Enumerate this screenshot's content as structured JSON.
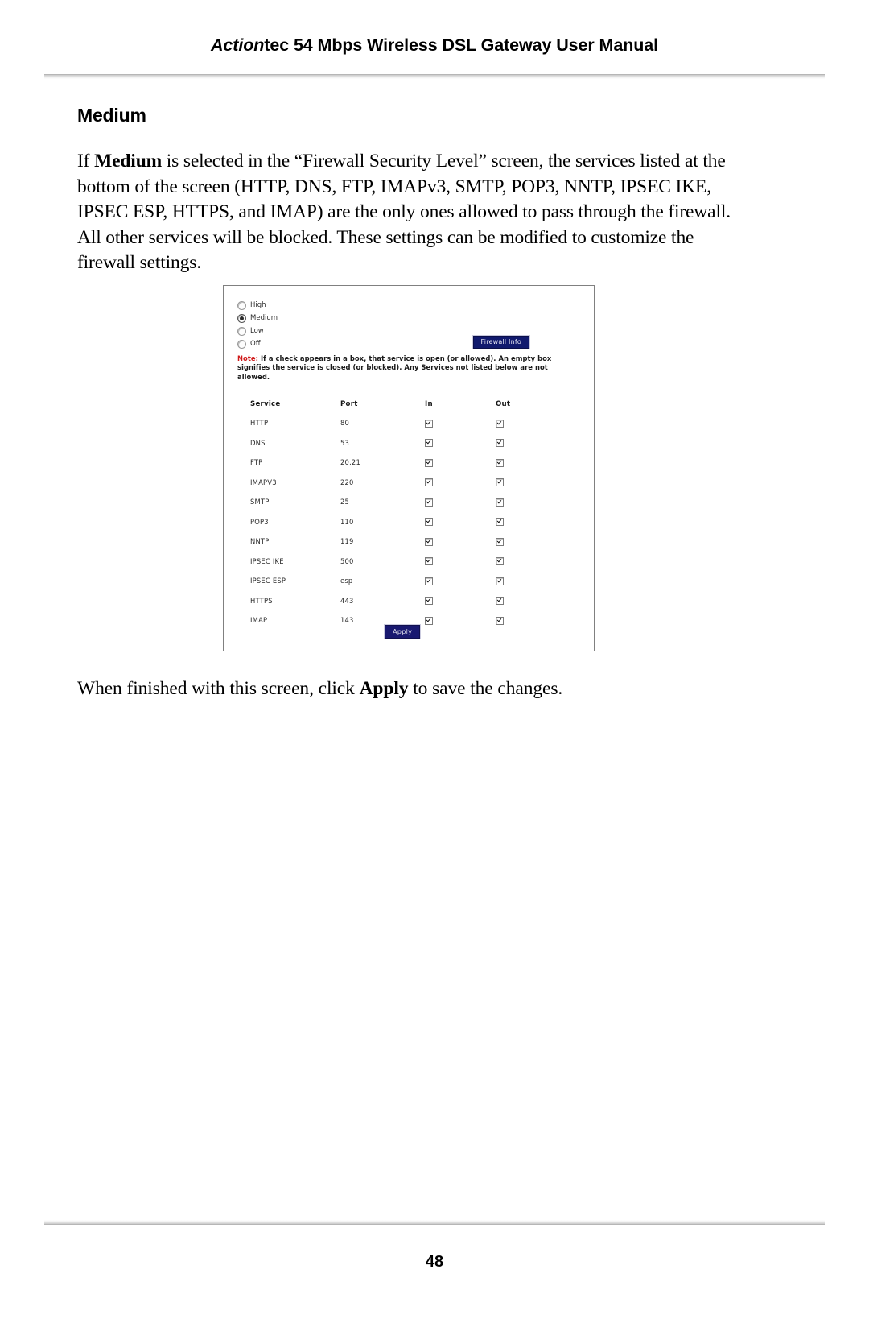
{
  "header": {
    "title_brand": "Action",
    "title_rest": "tec 54 Mbps Wireless DSL Gateway User Manual"
  },
  "section": {
    "heading": "Medium",
    "paragraph_lead": "If ",
    "paragraph_bold": "Medium",
    "paragraph_body": " is selected in the “Firewall Security Level” screen, the services listed at the bottom of the screen (HTTP, DNS, FTP, IMAPv3, SMTP, POP3, NNTP, IPSEC IKE, IPSEC ESP, HTTPS, and IMAP) are the only ones allowed to pass through the firewall. All other services will be blocked. These settings can be modified to customize the firewall settings."
  },
  "screenshot": {
    "security_levels": [
      {
        "label": "High",
        "selected": false
      },
      {
        "label": "Medium",
        "selected": true
      },
      {
        "label": "Low",
        "selected": false
      },
      {
        "label": "Off",
        "selected": false
      }
    ],
    "firewall_info_button": "Firewall Info",
    "note_label": "Note:",
    "note_text": " If a check appears in a box, that service is open (or allowed). An empty box signifies the service is closed (or blocked). Any Services not listed below are not allowed.",
    "table": {
      "columns": [
        "Service",
        "Port",
        "In",
        "Out"
      ],
      "rows": [
        {
          "service": "HTTP",
          "port": "80",
          "in": true,
          "out": true
        },
        {
          "service": "DNS",
          "port": "53",
          "in": true,
          "out": true
        },
        {
          "service": "FTP",
          "port": "20,21",
          "in": true,
          "out": true
        },
        {
          "service": "IMAPV3",
          "port": "220",
          "in": true,
          "out": true
        },
        {
          "service": "SMTP",
          "port": "25",
          "in": true,
          "out": true
        },
        {
          "service": "POP3",
          "port": "110",
          "in": true,
          "out": true
        },
        {
          "service": "NNTP",
          "port": "119",
          "in": true,
          "out": true
        },
        {
          "service": "IPSEC IKE",
          "port": "500",
          "in": true,
          "out": true
        },
        {
          "service": "IPSEC ESP",
          "port": "esp",
          "in": true,
          "out": true
        },
        {
          "service": "HTTPS",
          "port": "443",
          "in": true,
          "out": true
        },
        {
          "service": "IMAP",
          "port": "143",
          "in": true,
          "out": true
        }
      ]
    },
    "apply_button": "Apply",
    "colors": {
      "button_background": "#191970",
      "note_label": "#d01a1a",
      "frame_border": "#808080"
    }
  },
  "closing": {
    "lead": "When finished with this screen, click ",
    "bold": "Apply",
    "tail": " to save the changes."
  },
  "footer": {
    "page_number": "48"
  }
}
